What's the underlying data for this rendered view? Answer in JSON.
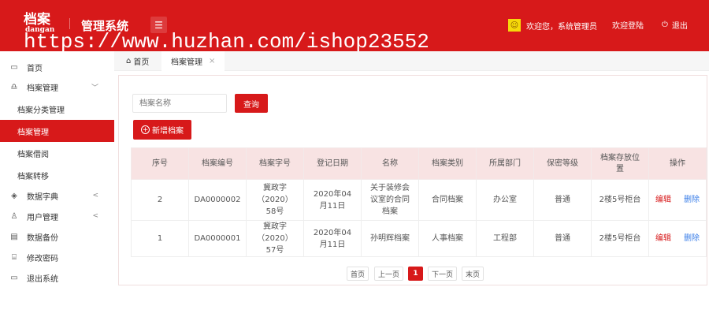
{
  "header": {
    "logo": "档案",
    "logo_sub": "dangan",
    "title": "管理系统",
    "watermark": "https://www.huzhan.com/ishop23552",
    "welcome": "欢迎您，系统管理员",
    "login": "欢迎登陆",
    "logout": "退出"
  },
  "sidebar": {
    "items": [
      {
        "label": "首页",
        "icon": "monitor-icon"
      },
      {
        "label": "档案管理",
        "icon": "archive-icon",
        "arrow": "﹀"
      },
      {
        "label": "档案分类管理"
      },
      {
        "label": "档案管理",
        "active": true
      },
      {
        "label": "档案借阅"
      },
      {
        "label": "档案转移"
      },
      {
        "label": "数据字典",
        "icon": "tag-icon",
        "arrow": "<"
      },
      {
        "label": "用户管理",
        "icon": "user-icon",
        "arrow": "<"
      },
      {
        "label": "数据备份",
        "icon": "backup-icon"
      },
      {
        "label": "修改密码",
        "icon": "password-icon"
      },
      {
        "label": "退出系统",
        "icon": "exit-icon"
      }
    ]
  },
  "tabs": [
    {
      "label": "首页"
    },
    {
      "label": "档案管理",
      "close": "×"
    }
  ],
  "search": {
    "placeholder": "档案名称",
    "button": "查询"
  },
  "add_button": "新增档案",
  "table": {
    "headers": [
      "序号",
      "档案编号",
      "档案字号",
      "登记日期",
      "名称",
      "档案类别",
      "所属部门",
      "保密等级",
      "档案存放位置",
      "操作"
    ],
    "rows": [
      [
        "2",
        "DA0000002",
        "冀政字（2020）58号",
        "2020年04月11日",
        "关于装修会议室的合同档案",
        "合同档案",
        "办公室",
        "普通",
        "2楼5号柜台"
      ],
      [
        "1",
        "DA0000001",
        "冀政字（2020）57号",
        "2020年04月11日",
        "孙明辉档案",
        "人事档案",
        "工程部",
        "普通",
        "2楼5号柜台"
      ]
    ],
    "edit": "编辑",
    "delete": "删除"
  },
  "pagination": {
    "first": "首页",
    "prev": "上一页",
    "current": "1",
    "next": "下一页",
    "last": "末页"
  }
}
